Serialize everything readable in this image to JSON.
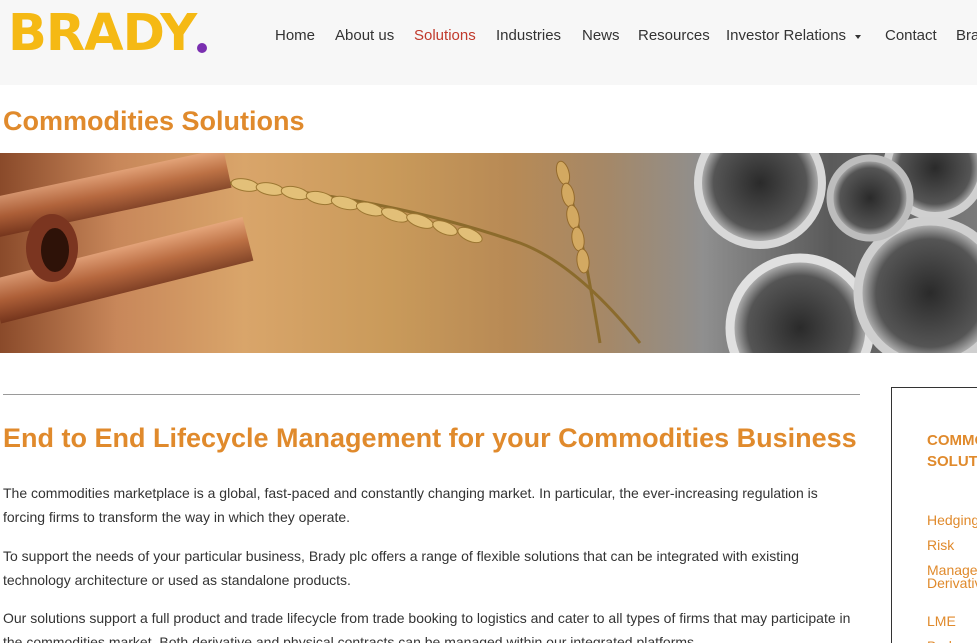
{
  "header": {
    "logo_text": "BRADY",
    "logo_colors": {
      "text": "#f5b914",
      "dot": "#7a2fb0"
    },
    "nav": [
      {
        "label": "Home"
      },
      {
        "label": "About us"
      },
      {
        "label": "Solutions",
        "active": true
      },
      {
        "label": "Industries"
      },
      {
        "label": "News"
      },
      {
        "label": "Resources"
      },
      {
        "label": "Investor Relations",
        "has_dropdown": true
      },
      {
        "label": "Contact"
      },
      {
        "label": "Bra"
      }
    ]
  },
  "page": {
    "title": "Commodities Solutions",
    "banner_icon": "commodities-banner-image"
  },
  "main": {
    "heading": "End to End Lifecycle Management for your Commodities Business",
    "paragraphs": [
      "The commodities marketplace is a global, fast-paced and constantly changing market. In particular, the ever-increasing regulation is forcing firms to transform the way in which they operate.",
      "To support the needs of your particular business, Brady plc offers a range of flexible solutions that can be integrated with existing technology architecture or used as standalone products.",
      "Our solutions support a full product and trade lifecycle from trade booking to logistics and cater to all types of firms that may participate in the commodities market. Both derivative and physical contracts can be managed within our integrated platforms."
    ]
  },
  "sidebar": {
    "title": "COMMODITIES SOLUTIONS",
    "links": [
      {
        "label": "Hedging & Risk Management"
      },
      {
        "label": "Derivatives"
      },
      {
        "label": "LME Brokers"
      }
    ]
  },
  "colors": {
    "accent": "#e08a2c",
    "active_nav": "#c0392b",
    "header_bg": "#f7f7f7"
  }
}
